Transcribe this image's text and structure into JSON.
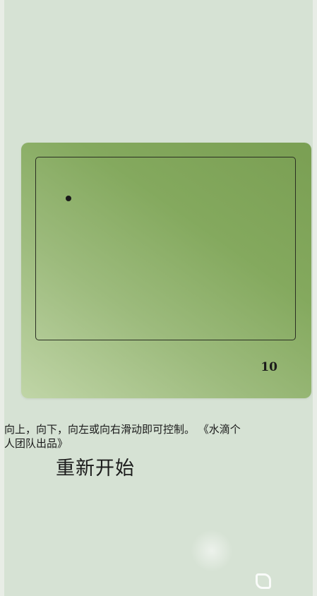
{
  "game": {
    "score": "10"
  },
  "instructions": {
    "line1": "向上，向下，向左或向右滑动即可控制。 《水滴个",
    "line2": "人团队出品》"
  },
  "controls": {
    "restart_label": "重新开始"
  },
  "watermark": {
    "logo_icon": "9you-logo-icon"
  },
  "colors": {
    "background": "#d6e2d4",
    "panel_dark": "#7a9f53",
    "panel_light": "#c0d5a7",
    "board_border": "#2a2f22"
  }
}
